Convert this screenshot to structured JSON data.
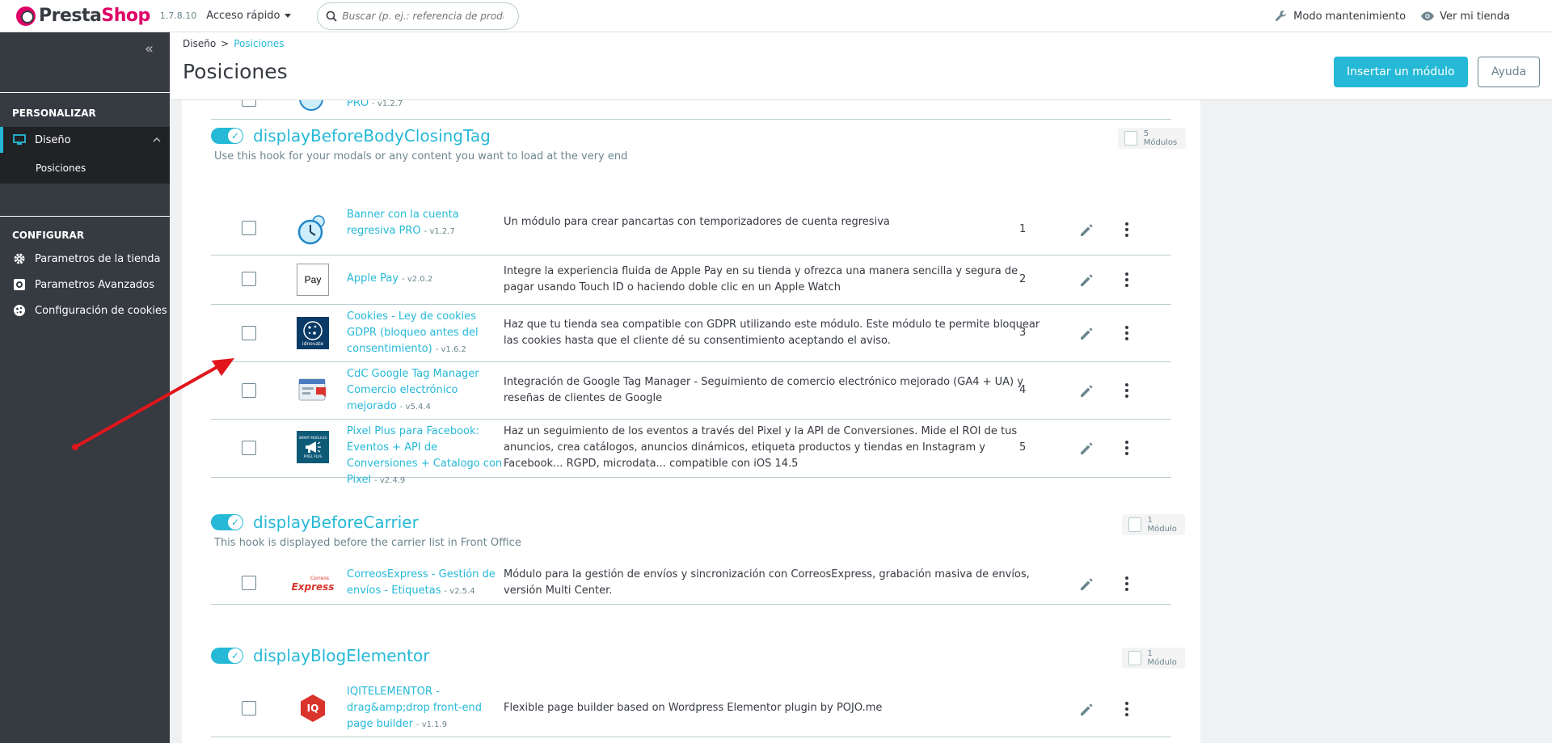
{
  "header": {
    "brand_presta": "Presta",
    "brand_shop": "Shop",
    "version": "1.7.8.10",
    "quick_access": "Acceso rápido",
    "search_placeholder": "Buscar (p. ej.: referencia de producto,",
    "maintenance": "Modo mantenimiento",
    "view_store": "Ver mi tienda"
  },
  "sidebar": {
    "section1_title": "PERSONALIZAR",
    "design_label": "Diseño",
    "positions_label": "Posiciones",
    "section2_title": "CONFIGURAR",
    "items": [
      {
        "label": "Parametros de la tienda"
      },
      {
        "label": "Parametros Avanzados"
      },
      {
        "label": "Configuración de cookies"
      }
    ]
  },
  "page": {
    "breadcrumb_parent": "Diseño",
    "breadcrumb_sep": ">",
    "breadcrumb_current": "Posiciones",
    "title": "Posiciones",
    "insert_button": "Insertar un módulo",
    "help_button": "Ayuda"
  },
  "partial_row": {
    "name": "PRO",
    "version": "- v1.2.7"
  },
  "hooks": [
    {
      "name": "displayBeforeBodyClosingTag",
      "description": "Use this hook for your modals or any content you want to load at the very end",
      "count": "5 Módulos",
      "modules": [
        {
          "name": "Banner con la cuenta regresiva PRO",
          "version": "- v1.2.7",
          "description": "Un módulo para crear pancartas con temporizadores de cuenta regresiva",
          "position": "1"
        },
        {
          "name": "Apple Pay",
          "version": "- v2.0.2",
          "description": "Integre la experiencia fluida de Apple Pay en su tienda y ofrezca una manera sencilla y segura de pagar usando Touch ID o haciendo doble clic en un Apple Watch",
          "position": "2"
        },
        {
          "name": "Cookies - Ley de cookies GDPR (bloqueo antes del consentimiento)",
          "version": "- v1.6.2",
          "description": "Haz que tu tienda sea compatible con GDPR utilizando este módulo. Este módulo te permite bloquear las cookies hasta que el cliente dé su consentimiento aceptando el aviso.",
          "position": "3"
        },
        {
          "name": "CdC Google Tag Manager Comercio electrónico mejorado",
          "version": "- v5.4.4",
          "description": "Integración de Google Tag Manager - Seguimiento de comercio electrónico mejorado (GA4 + UA) y reseñas de clientes de Google",
          "position": "4"
        },
        {
          "name": "Pixel Plus para Facebook: Eventos + API de Conversiones + Catalogo con Pixel",
          "version": "- v2.4.9",
          "description": "Haz un seguimiento de los eventos a través del Pixel y la API de Conversiones. Mide el ROI de tus anuncios, crea catálogos, anuncios dinámicos, etiqueta productos y tiendas en Instagram y Facebook... RGPD, microdata... compatible con iOS 14.5",
          "position": "5"
        }
      ]
    },
    {
      "name": "displayBeforeCarrier",
      "description": "This hook is displayed before the carrier list in Front Office",
      "count": "1 Módulo",
      "modules": [
        {
          "name": "CorreosExpress - Gestión de envíos - Etiquetas",
          "version": "- v2.5.4",
          "description": "Módulo para la gestión de envíos y sincronización con CorreosExpress, grabación masiva de envíos, versión Multi Center.",
          "position": ""
        }
      ]
    },
    {
      "name": "displayBlogElementor",
      "description": "",
      "count": "1 Módulo",
      "modules": [
        {
          "name": "IQITELEMENTOR - drag&amp;drop front-end page builder",
          "version": "- v1.1.9",
          "description": "Flexible page builder based on Wordpress Elementor plugin by POJO.me",
          "position": ""
        }
      ]
    }
  ],
  "logos": {
    "apple_pay_text": "Pay",
    "idnovate_text": "idnovate",
    "correos_top": "Correos",
    "correos_bottom": "Express",
    "iq_text": "IQ",
    "pixel_top": "SMART MODULES",
    "pixel_bottom": "PIXEL PLUS"
  },
  "colors": {
    "accent": "#25b9d7",
    "sidebar": "#363a41",
    "sidebar_active": "#202226",
    "brand_pink": "#df0067",
    "arrow": "#e0161b"
  }
}
